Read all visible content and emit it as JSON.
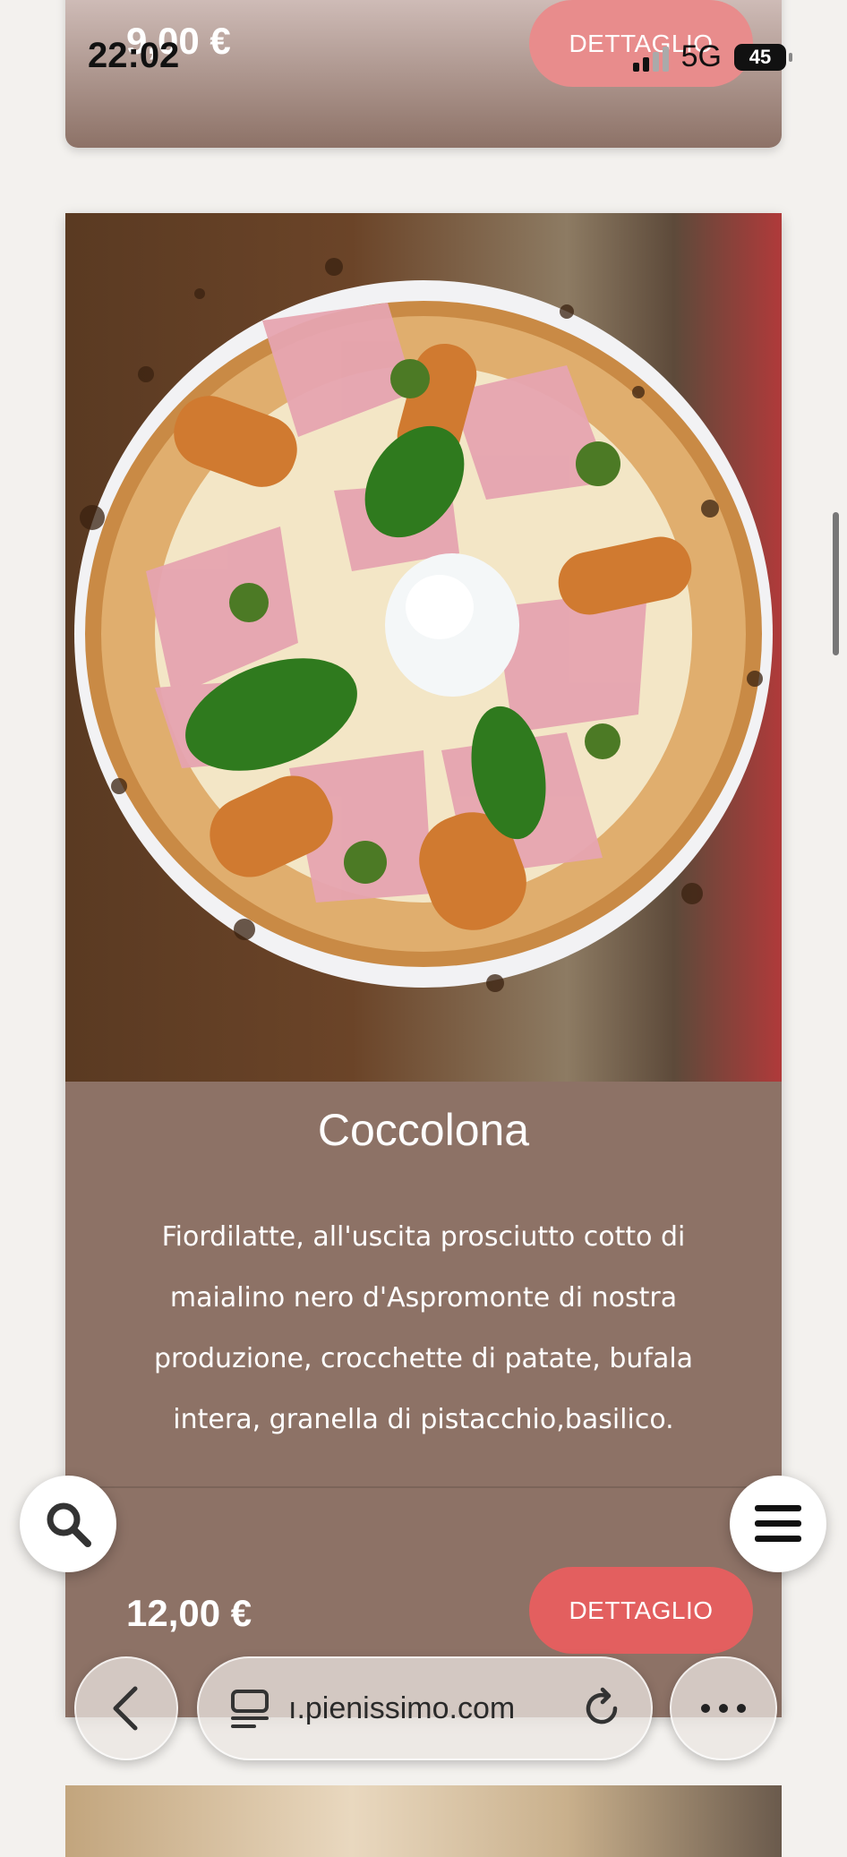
{
  "status_bar": {
    "time": "22:02",
    "network": "5G",
    "battery": "45"
  },
  "previous_item": {
    "price": "9,00 €",
    "detail_button": "DETTAGLIO"
  },
  "item": {
    "title": "Coccolona",
    "description": "Fiordilatte, all'uscita prosciutto cotto di maialino nero d'Aspromonte di nostra produzione, crocchette di patate, bufala intera, granella di pistacchio,basilico.",
    "price": "12,00 €",
    "detail_button": "DETTAGLIO"
  },
  "browser": {
    "url": "pienissimo.com",
    "url_display": "ı.pienissimo.com"
  },
  "colors": {
    "card_bg": "#8d7266",
    "button_bg": "#e35f5f",
    "page_bg": "#f3f1ee"
  },
  "icons": {
    "search": "search-icon",
    "menu": "hamburger-icon",
    "back": "chevron-left-icon",
    "tabs": "tab-list-icon",
    "reload": "reload-icon",
    "more": "more-dots-icon"
  }
}
